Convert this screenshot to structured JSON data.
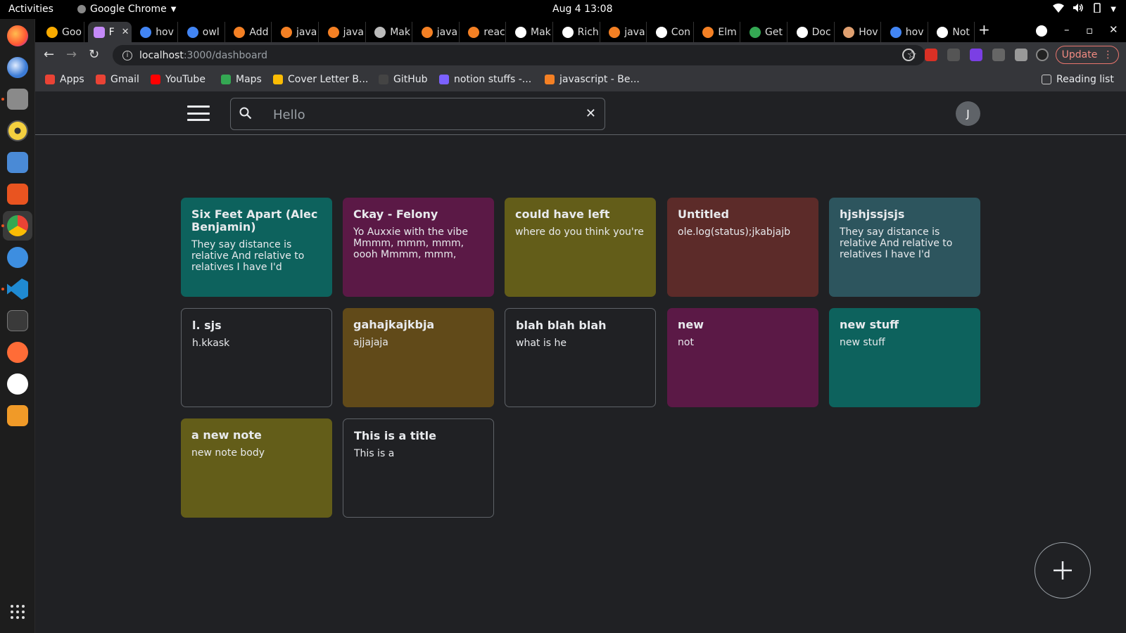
{
  "system": {
    "activities": "Activities",
    "app_name": "Google Chrome",
    "clock": "Aug 4  13:08"
  },
  "browser": {
    "tabs": [
      {
        "label": "Goo",
        "color": "#f9ab00"
      },
      {
        "label": "F",
        "color": "#c58af9",
        "active": true
      },
      {
        "label": "hov",
        "color": "#4285f4"
      },
      {
        "label": "owl",
        "color": "#4285f4"
      },
      {
        "label": "Add",
        "color": "#f48024"
      },
      {
        "label": "java",
        "color": "#f48024"
      },
      {
        "label": "java",
        "color": "#f48024"
      },
      {
        "label": "Mak",
        "color": "#bbbbbb"
      },
      {
        "label": "java",
        "color": "#f48024"
      },
      {
        "label": "reac",
        "color": "#f48024"
      },
      {
        "label": "Mak",
        "color": "#ffffff"
      },
      {
        "label": "Rich",
        "color": "#ffffff"
      },
      {
        "label": "java",
        "color": "#f48024"
      },
      {
        "label": "Con",
        "color": "#ffffff"
      },
      {
        "label": "Elm",
        "color": "#f48024"
      },
      {
        "label": "Get",
        "color": "#34a853"
      },
      {
        "label": "Doc",
        "color": "#ffffff"
      },
      {
        "label": "Hov",
        "color": "#e0a070"
      },
      {
        "label": "hov",
        "color": "#4285f4"
      },
      {
        "label": "Not",
        "color": "#ffffff"
      }
    ],
    "url_host": "localhost",
    "url_path": ":3000/dashboard",
    "update_label": "Update",
    "bookmarks": [
      {
        "label": "Apps",
        "color": "#ea4335"
      },
      {
        "label": "Gmail",
        "color": "#ea4335"
      },
      {
        "label": "YouTube",
        "color": "#ff0000"
      },
      {
        "label": "Maps",
        "color": "#34a853"
      },
      {
        "label": "Cover Letter B...",
        "color": "#fbbc04"
      },
      {
        "label": "GitHub",
        "color": "#444444"
      },
      {
        "label": "notion stuffs -...",
        "color": "#7b61ff"
      },
      {
        "label": "javascript - Be...",
        "color": "#f48024"
      }
    ],
    "reading_list": "Reading list"
  },
  "app": {
    "search_value": "Hello",
    "avatar_initial": "J",
    "notes": [
      {
        "title": "Six Feet Apart (Alec Benjamin)",
        "body": "They say distance is relative And relative to relatives I have I'd",
        "color": "#0d625d"
      },
      {
        "title": "Ckay - Felony",
        "body": "Yo Auxxie with the vibe Mmmm, mmm, mmm, oooh Mmmm, mmm, mmm,",
        "color": "#5b1946"
      },
      {
        "title": "could have left",
        "body": "where do you think you're",
        "color": "#635d19"
      },
      {
        "title": "Untitled",
        "body": "ole.log(status);jkabjajb",
        "color": "#5c2b29"
      },
      {
        "title": "hjshjssjsjs",
        "body": "They say distance is relative And relative to relatives I have I'd",
        "color": "#2d555e"
      },
      {
        "title": "l. sjs",
        "body": "h.kkask",
        "color": ""
      },
      {
        "title": "gahajkajkbja",
        "body": "ajjajaja",
        "color": "#614a19"
      },
      {
        "title": "blah blah blah",
        "body": "what is he",
        "color": ""
      },
      {
        "title": "new",
        "body": "not",
        "color": "#5b1946"
      },
      {
        "title": "new stuff",
        "body": "new stuff",
        "color": "#0d625d"
      },
      {
        "title": "a new note",
        "body": "new note body",
        "color": "#635d19"
      },
      {
        "title": "This is a title",
        "body": "This is a",
        "color": ""
      }
    ]
  }
}
